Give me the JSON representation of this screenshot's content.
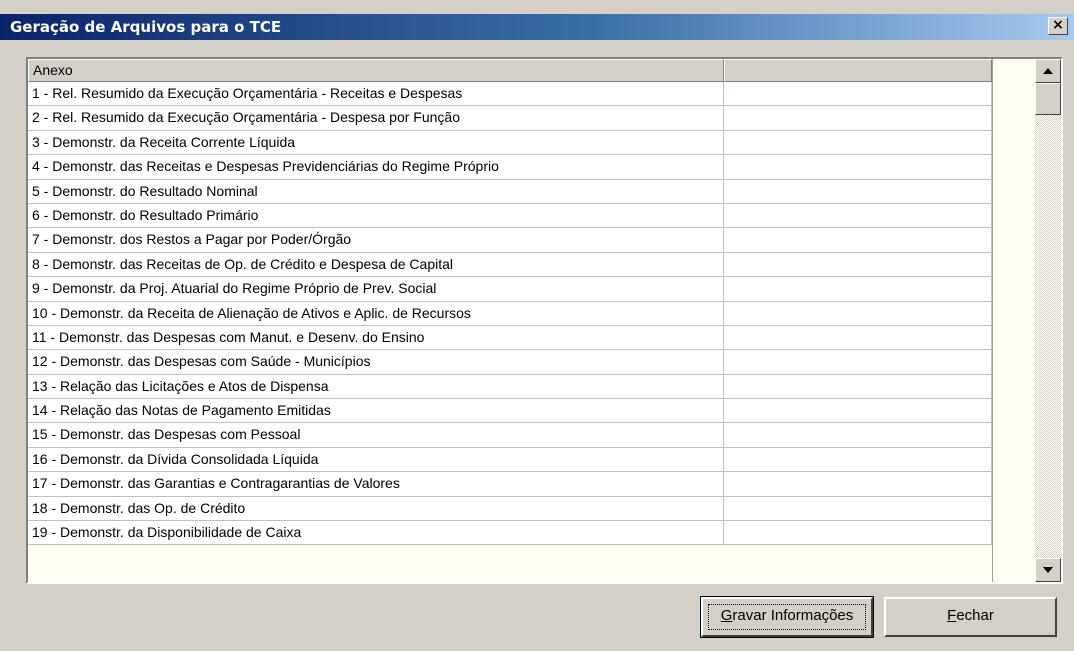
{
  "window": {
    "title": "Geração de Arquivos para o TCE",
    "close_glyph": "×"
  },
  "grid": {
    "columns": [
      "Anexo",
      ""
    ],
    "rows": [
      {
        "annex": "1 - Rel. Resumido da Execução Orçamentária - Receitas e Despesas",
        "value": ""
      },
      {
        "annex": "2 - Rel. Resumido da Execução Orçamentária - Despesa por Função",
        "value": ""
      },
      {
        "annex": "3 - Demonstr. da Receita Corrente Líquida",
        "value": ""
      },
      {
        "annex": "4 - Demonstr. das Receitas e Despesas Previdenciárias do Regime Próprio",
        "value": ""
      },
      {
        "annex": "5 - Demonstr. do Resultado Nominal",
        "value": ""
      },
      {
        "annex": "6 - Demonstr. do Resultado Primário",
        "value": ""
      },
      {
        "annex": "7 - Demonstr. dos Restos a Pagar por Poder/Órgão",
        "value": ""
      },
      {
        "annex": "8 - Demonstr. das Receitas de Op. de Crédito e Despesa de Capital",
        "value": ""
      },
      {
        "annex": "9 - Demonstr. da Proj. Atuarial do Regime Próprio de Prev. Social",
        "value": ""
      },
      {
        "annex": "10 - Demonstr. da Receita de Alienação de Ativos e Aplic. de Recursos",
        "value": ""
      },
      {
        "annex": "11 - Demonstr. das Despesas com Manut. e Desenv. do Ensino",
        "value": ""
      },
      {
        "annex": "12 - Demonstr. das Despesas com Saúde - Municípios",
        "value": ""
      },
      {
        "annex": "13 - Relação das Licitações e Atos de Dispensa",
        "value": ""
      },
      {
        "annex": "14 - Relação das Notas de Pagamento Emitidas",
        "value": ""
      },
      {
        "annex": "15 - Demonstr. das Despesas com Pessoal",
        "value": ""
      },
      {
        "annex": "16 - Demonstr. da Dívida Consolidada Líquida",
        "value": ""
      },
      {
        "annex": "17 - Demonstr. das Garantias e Contragarantias de Valores",
        "value": ""
      },
      {
        "annex": "18 - Demonstr. das Op. de Crédito",
        "value": ""
      },
      {
        "annex": "19 - Demonstr. da Disponibilidade de Caixa",
        "value": ""
      }
    ]
  },
  "buttons": {
    "save": {
      "accel": "G",
      "rest": "ravar Informações"
    },
    "close": {
      "accel": "F",
      "rest": "echar"
    }
  },
  "colors": {
    "titlebar_start": "#0a246a",
    "titlebar_end": "#a6caf0",
    "window_face": "#d4d0c8",
    "grid_background": "#fffff0"
  }
}
